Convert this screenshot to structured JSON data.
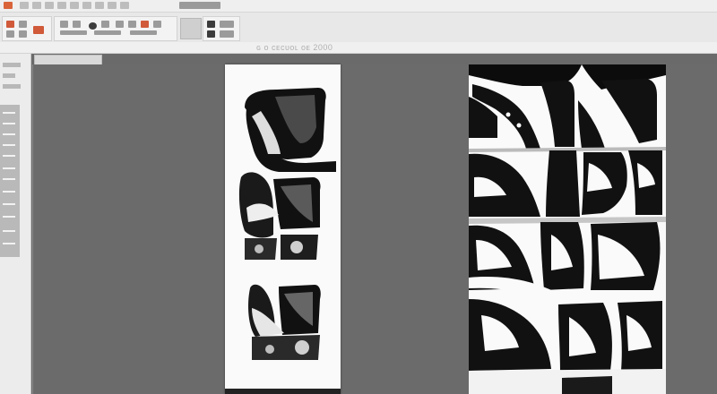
{
  "window": {
    "title": ""
  },
  "toolbar": {
    "groups": [
      "file-tools",
      "edit-tools",
      "view-tools"
    ]
  },
  "status": {
    "text": "ɢ ᴏ ᴄᴇᴄᴜᴏʟ ᴏᴇ 2000"
  },
  "colors": {
    "ribbon_bg": "#e8e8e8",
    "canvas_bg": "#6b6b6b",
    "brand": "#d9643a",
    "ink": "#111111",
    "paper": "#fafafa"
  },
  "icons": [
    "brand-icon",
    "open-icon",
    "save-icon",
    "print-icon",
    "undo-icon",
    "brush-icon",
    "shape-icon",
    "text-icon"
  ]
}
